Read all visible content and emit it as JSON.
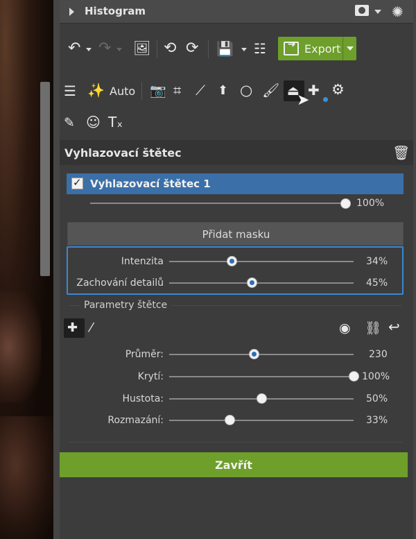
{
  "histogram": {
    "title": "Histogram"
  },
  "toolbar": {
    "export_label": "Export",
    "auto_label": "Auto"
  },
  "section": {
    "title": "Vyhlazovací štětec"
  },
  "layer": {
    "name": "Vyhlazovací štětec 1",
    "checked": true,
    "opacity_value": "100%",
    "opacity": 1.0
  },
  "mask": {
    "button_label": "Přidat masku"
  },
  "mask_params": [
    {
      "label": "Intenzita",
      "value": "34%",
      "level": 0.34
    },
    {
      "label": "Zachování detailů",
      "value": "45%",
      "level": 0.45
    }
  ],
  "brush": {
    "title": "Parametry štětce",
    "params": [
      {
        "label": "Průměr:",
        "value": "230",
        "level": 0.46
      },
      {
        "label": "Krytí:",
        "value": "100%",
        "level": 1.0
      },
      {
        "label": "Hustota:",
        "value": "50%",
        "level": 0.5
      },
      {
        "label": "Rozmazání:",
        "value": "33%",
        "level": 0.33
      }
    ]
  },
  "footer": {
    "close_label": "Zavřít"
  },
  "colors": {
    "accent_green": "#6d9f2a",
    "selection_blue": "#3b6fa8",
    "focus_border": "#3a87d4"
  }
}
